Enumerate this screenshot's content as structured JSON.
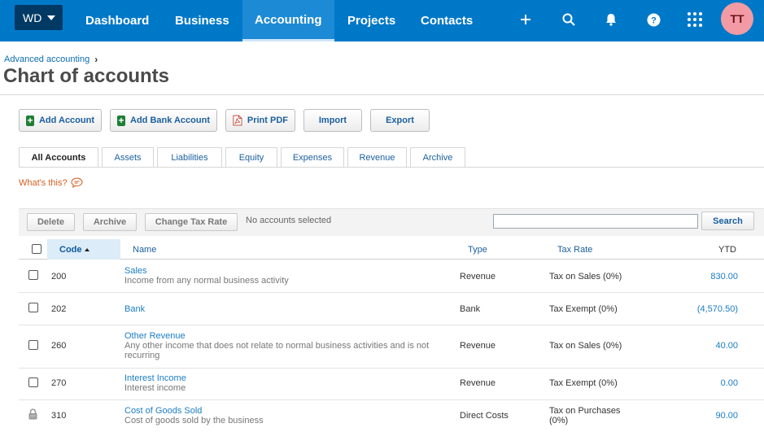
{
  "nav": {
    "org": "WD",
    "items": [
      {
        "label": "Dashboard",
        "active": false
      },
      {
        "label": "Business",
        "active": false
      },
      {
        "label": "Accounting",
        "active": true
      },
      {
        "label": "Projects",
        "active": false
      },
      {
        "label": "Contacts",
        "active": false
      }
    ],
    "icons": [
      "plus-icon",
      "search-icon",
      "bell-icon",
      "help-icon",
      "apps-grid-icon"
    ],
    "avatar_initials": "TT"
  },
  "header": {
    "breadcrumb": "Advanced accounting",
    "title": "Chart of accounts"
  },
  "toolbar": {
    "add_account": "Add Account",
    "add_bank_account": "Add Bank Account",
    "print_pdf": "Print PDF",
    "import": "Import",
    "export": "Export"
  },
  "tabs": [
    {
      "label": "All Accounts",
      "active": true
    },
    {
      "label": "Assets",
      "active": false
    },
    {
      "label": "Liabilities",
      "active": false
    },
    {
      "label": "Equity",
      "active": false
    },
    {
      "label": "Expenses",
      "active": false
    },
    {
      "label": "Revenue",
      "active": false
    },
    {
      "label": "Archive",
      "active": false
    }
  ],
  "help": {
    "whats_this": "What's this?"
  },
  "grid": {
    "delete": "Delete",
    "archive": "Archive",
    "change_tax_rate": "Change Tax Rate",
    "selection_status": "No accounts selected",
    "search_value": "",
    "search_button": "Search"
  },
  "columns": {
    "code": "Code",
    "name": "Name",
    "type": "Type",
    "tax_rate": "Tax Rate",
    "ytd": "YTD"
  },
  "rows": [
    {
      "code": "200",
      "name": "Sales",
      "description": "Income from any normal business activity",
      "type": "Revenue",
      "tax_rate": "Tax on Sales (0%)",
      "ytd": "830.00",
      "locked": false
    },
    {
      "code": "202",
      "name": "Bank",
      "description": "",
      "type": "Bank",
      "tax_rate": "Tax Exempt (0%)",
      "ytd": "(4,570.50)",
      "locked": false
    },
    {
      "code": "260",
      "name": "Other Revenue",
      "description": "Any other income that does not relate to normal business activities and is not recurring",
      "type": "Revenue",
      "tax_rate": "Tax on Sales (0%)",
      "ytd": "40.00",
      "locked": false
    },
    {
      "code": "270",
      "name": "Interest Income",
      "description": "Interest income",
      "type": "Revenue",
      "tax_rate": "Tax Exempt (0%)",
      "ytd": "0.00",
      "locked": false
    },
    {
      "code": "310",
      "name": "Cost of Goods Sold",
      "description": "Cost of goods sold by the business",
      "type": "Direct Costs",
      "tax_rate": "Tax on Purchases (0%)",
      "ytd": "90.00",
      "locked": true
    }
  ],
  "colors": {
    "nav_bg": "#0078c8",
    "link": "#1b7dc4",
    "accent_orange": "#d35d1d",
    "avatar_bg": "#f29ba4"
  }
}
